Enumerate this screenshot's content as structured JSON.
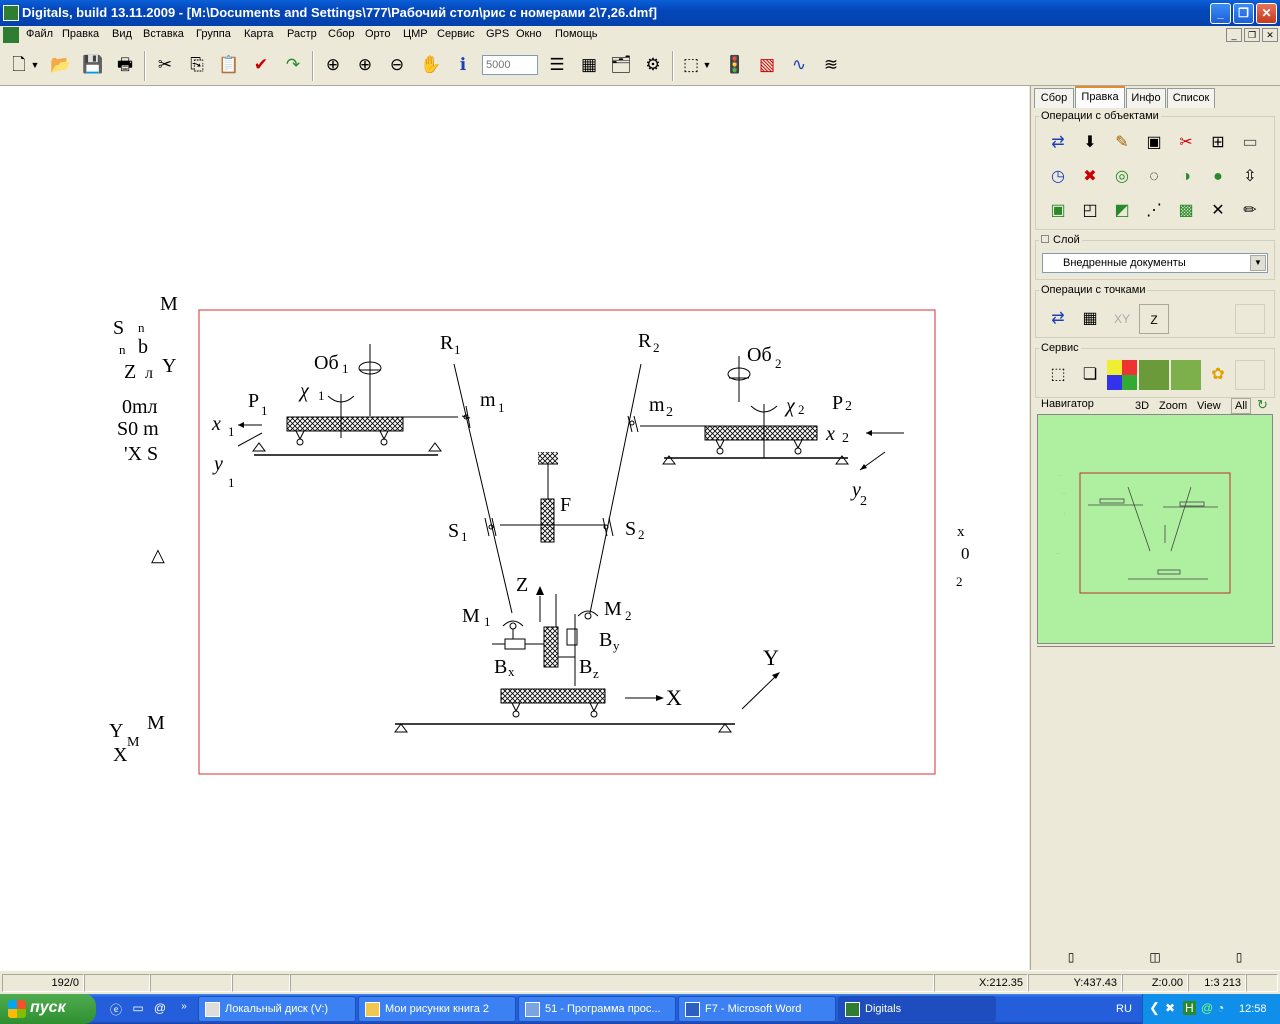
{
  "title_bar": {
    "title": "Digitals, build 13.11.2009 - [M:\\Documents and Settings\\777\\Рабочий стол\\рис с номерами 2\\7,26.dmf]"
  },
  "menu": [
    "Файл",
    "Правка",
    "Вид",
    "Вставка",
    "Группа",
    "Карта",
    "Растр",
    "Сбор",
    "Орто",
    "ЦМР",
    "Сервис",
    "GPS",
    "Окно",
    "Помощь"
  ],
  "toolbar": {
    "zoom_placeholder": "5000"
  },
  "panel": {
    "tabs": [
      "Сбор",
      "Правка",
      "Инфо",
      "Список"
    ],
    "active_tab": "Правка",
    "group_objects": "Операции с объектами",
    "group_layer": "Слой",
    "layer_value": "Внедренные документы",
    "group_points": "Операции с точками",
    "points_xy": "XY",
    "points_z": "Z",
    "group_service": "Сервис",
    "navigator": {
      "label": "Навигатор",
      "btn_3d": "3D",
      "btn_zoom": "Zoom",
      "btn_view": "View",
      "btn_all": "All"
    }
  },
  "drawing": {
    "ob1": "Об",
    "ob1_sub": "1",
    "ob2": "Об",
    "ob2_sub": "2",
    "R": "R",
    "sub1": "1",
    "sub2": "2",
    "chi": "χ",
    "P": "P",
    "m": "m",
    "S": "S",
    "x": "x",
    "y": "y",
    "F": "F",
    "Z": "Z",
    "M": "M",
    "B": "B",
    "sub_x": "x",
    "sub_z": "z",
    "sub_y": "y",
    "X": "X",
    "Y": "Y"
  },
  "stray_text": {
    "s_M": "M",
    "s_Sn": "S",
    "s_n": "n",
    "s_nb_n": "n",
    "s_b": "b",
    "s_Z": "Z",
    "s_l": "л",
    "s_Y": "Y",
    "s_0ml": "0mл",
    "s_S0m": "S0 m",
    "s_XS": "'X S",
    "s_tri": "△",
    "s_x": "x",
    "s_0": "0",
    "s_2": "2",
    "s_YM": "Y",
    "s_YMsub": "M",
    "s_M2": "M",
    "s_X": "X"
  },
  "status": {
    "cell1": "192/0",
    "x": "X:212.35",
    "y": "Y:437.43",
    "z": "Z:0.00",
    "scale": "1:3 213"
  },
  "taskbar": {
    "start": "пуск",
    "tasks": [
      "Локальный диск (V:)",
      "Мои рисунки книга 2",
      "51 - Программа прос...",
      "F7 - Microsoft Word",
      "Digitals"
    ],
    "lang": "RU",
    "clock": "12:58"
  }
}
